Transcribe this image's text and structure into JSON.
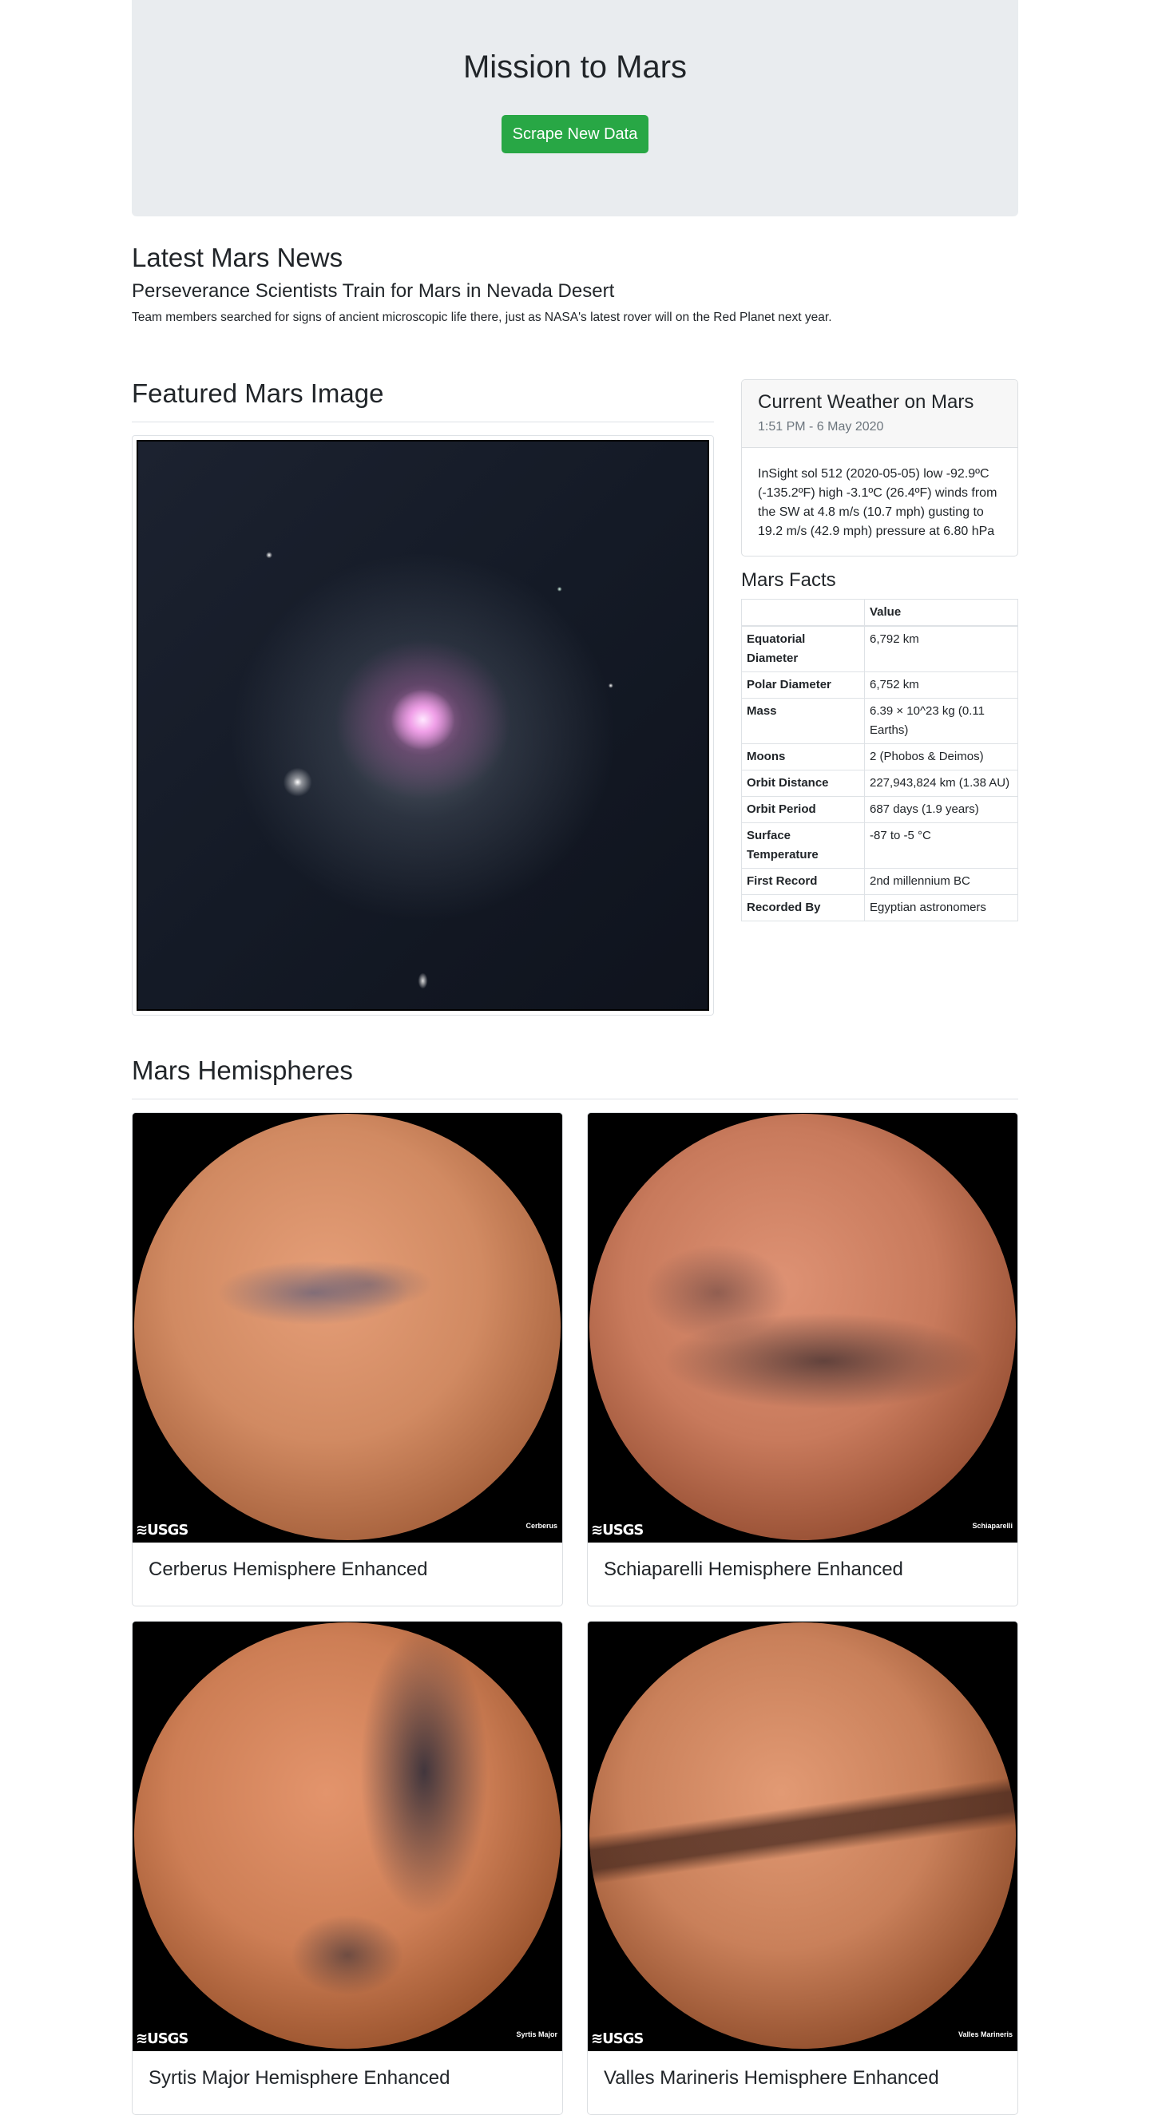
{
  "jumbotron": {
    "title": "Mission to Mars",
    "button_label": "Scrape New Data"
  },
  "news": {
    "heading": "Latest Mars News",
    "title": "Perseverance Scientists Train for Mars in Nevada Desert",
    "teaser": "Team members searched for signs of ancient microscopic life there, just as NASA's latest rover will on the Red Planet next year."
  },
  "featured": {
    "heading": "Featured Mars Image"
  },
  "weather": {
    "title": "Current Weather on Mars",
    "time": "1:51 PM - 6 May 2020",
    "text": "InSight sol 512 (2020-05-05) low -92.9ºC (-135.2ºF) high -3.1ºC (26.4ºF) winds from the SW at 4.8 m/s (10.7 mph) gusting to 19.2 m/s (42.9 mph) pressure at 6.80 hPa"
  },
  "facts": {
    "heading": "Mars Facts",
    "value_header": "Value",
    "rows": [
      {
        "label": "Equatorial Diameter",
        "value": "6,792 km"
      },
      {
        "label": "Polar Diameter",
        "value": "6,752 km"
      },
      {
        "label": "Mass",
        "value": "6.39 × 10^23 kg (0.11 Earths)"
      },
      {
        "label": "Moons",
        "value": "2 (Phobos & Deimos)"
      },
      {
        "label": "Orbit Distance",
        "value": "227,943,824 km (1.38 AU)"
      },
      {
        "label": "Orbit Period",
        "value": "687 days (1.9 years)"
      },
      {
        "label": "Surface Temperature",
        "value": "-87 to -5 °C"
      },
      {
        "label": "First Record",
        "value": "2nd millennium BC"
      },
      {
        "label": "Recorded By",
        "value": "Egyptian astronomers"
      }
    ]
  },
  "hemispheres": {
    "heading": "Mars Hemispheres",
    "items": [
      {
        "title": "Cerberus Hemisphere Enhanced",
        "image_label": "Cerberus",
        "logo": "USGS"
      },
      {
        "title": "Schiaparelli Hemisphere Enhanced",
        "image_label": "Schiaparelli",
        "logo": "USGS"
      },
      {
        "title": "Syrtis Major Hemisphere Enhanced",
        "image_label": "Syrtis Major",
        "logo": "USGS"
      },
      {
        "title": "Valles Marineris Hemisphere Enhanced",
        "image_label": "Valles Marineris",
        "logo": "USGS"
      }
    ]
  },
  "colors": {
    "jumbotron_bg": "#e9ecef",
    "button_bg": "#28a745",
    "border": "#dee2e6"
  }
}
